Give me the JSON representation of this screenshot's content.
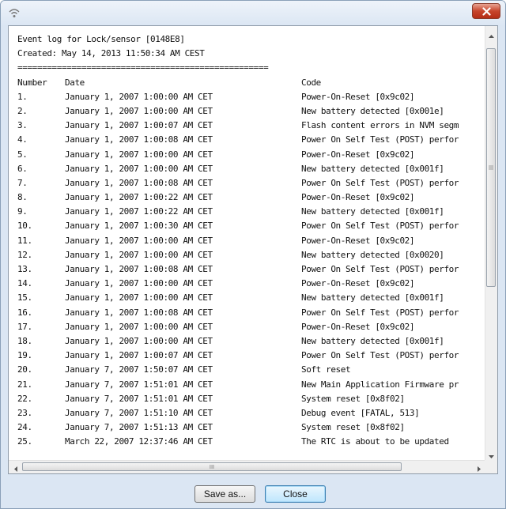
{
  "window": {
    "icon": "wireless-signal-icon",
    "close_icon": "close-icon"
  },
  "log": {
    "header_line": "Event log for Lock/sensor [0148E8]",
    "created_line": "Created: May 14, 2013 11:50:34 AM CEST",
    "separator": "===================================================",
    "columns": {
      "number": "Number",
      "date": "Date",
      "code": "Code"
    },
    "rows": [
      {
        "number": "1.",
        "date": "January 1, 2007 1:00:00 AM CET",
        "code": "Power-On-Reset [0x9c02]"
      },
      {
        "number": "2.",
        "date": "January 1, 2007 1:00:00 AM CET",
        "code": "New battery detected [0x001e]"
      },
      {
        "number": "3.",
        "date": "January 1, 2007 1:00:07 AM CET",
        "code": "Flash content errors in NVM segm"
      },
      {
        "number": "4.",
        "date": "January 1, 2007 1:00:08 AM CET",
        "code": "Power On Self Test (POST) perfor"
      },
      {
        "number": "5.",
        "date": "January 1, 2007 1:00:00 AM CET",
        "code": "Power-On-Reset [0x9c02]"
      },
      {
        "number": "6.",
        "date": "January 1, 2007 1:00:00 AM CET",
        "code": "New battery detected [0x001f]"
      },
      {
        "number": "7.",
        "date": "January 1, 2007 1:00:08 AM CET",
        "code": "Power On Self Test (POST) perfor"
      },
      {
        "number": "8.",
        "date": "January 1, 2007 1:00:22 AM CET",
        "code": "Power-On-Reset [0x9c02]"
      },
      {
        "number": "9.",
        "date": "January 1, 2007 1:00:22 AM CET",
        "code": "New battery detected [0x001f]"
      },
      {
        "number": "10.",
        "date": "January 1, 2007 1:00:30 AM CET",
        "code": "Power On Self Test (POST) perfor"
      },
      {
        "number": "11.",
        "date": "January 1, 2007 1:00:00 AM CET",
        "code": "Power-On-Reset [0x9c02]"
      },
      {
        "number": "12.",
        "date": "January 1, 2007 1:00:00 AM CET",
        "code": "New battery detected [0x0020]"
      },
      {
        "number": "13.",
        "date": "January 1, 2007 1:00:08 AM CET",
        "code": "Power On Self Test (POST) perfor"
      },
      {
        "number": "14.",
        "date": "January 1, 2007 1:00:00 AM CET",
        "code": "Power-On-Reset [0x9c02]"
      },
      {
        "number": "15.",
        "date": "January 1, 2007 1:00:00 AM CET",
        "code": "New battery detected [0x001f]"
      },
      {
        "number": "16.",
        "date": "January 1, 2007 1:00:08 AM CET",
        "code": "Power On Self Test (POST) perfor"
      },
      {
        "number": "17.",
        "date": "January 1, 2007 1:00:00 AM CET",
        "code": "Power-On-Reset [0x9c02]"
      },
      {
        "number": "18.",
        "date": "January 1, 2007 1:00:00 AM CET",
        "code": "New battery detected [0x001f]"
      },
      {
        "number": "19.",
        "date": "January 1, 2007 1:00:07 AM CET",
        "code": "Power On Self Test (POST) perfor"
      },
      {
        "number": "20.",
        "date": "January 7, 2007 1:50:07 AM CET",
        "code": "Soft reset"
      },
      {
        "number": "21.",
        "date": "January 7, 2007 1:51:01 AM CET",
        "code": "New Main Application Firmware pr"
      },
      {
        "number": "22.",
        "date": "January 7, 2007 1:51:01 AM CET",
        "code": "System reset [0x8f02]"
      },
      {
        "number": "23.",
        "date": "January 7, 2007 1:51:10 AM CET",
        "code": "Debug event [FATAL, 513]"
      },
      {
        "number": "24.",
        "date": "January 7, 2007 1:51:13 AM CET",
        "code": "System reset [0x8f02]"
      },
      {
        "number": "25.",
        "date": "March 22, 2007 12:37:46 AM CET",
        "code": "The RTC is about to be updated"
      }
    ]
  },
  "scrollbars": {
    "up_icon": "scroll-up-arrow-icon",
    "down_icon": "scroll-down-arrow-icon",
    "left_icon": "scroll-left-arrow-icon",
    "right_icon": "scroll-right-arrow-icon",
    "hthumb_grip": "III"
  },
  "buttons": {
    "save_label": "Save as...",
    "close_label": "Close"
  },
  "colors": {
    "window_frame": "#dbe6f3",
    "close_button": "#c7452c",
    "default_button": "#bee6fd"
  }
}
